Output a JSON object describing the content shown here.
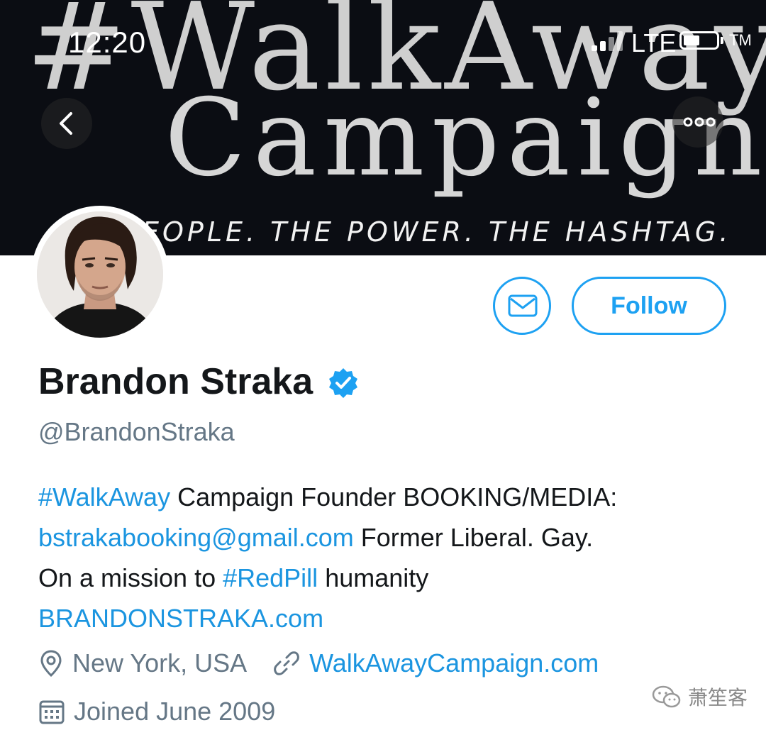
{
  "status_bar": {
    "time": "12:20",
    "network": "LTE",
    "tm": "TM"
  },
  "banner": {
    "line1": "#WalkAway",
    "line2": "Campaign",
    "tagline": "EOPLE.  THE POWER.  THE HASHTAG."
  },
  "profile": {
    "name": "Brandon Straka",
    "handle": "@BrandonStraka",
    "follow_label": "Follow",
    "bio": {
      "hashtag1": "#WalkAway",
      "text1": " Campaign Founder BOOKING/MEDIA:",
      "email": "bstrakabooking@gmail.com",
      "text2": " Former Liberal. Gay.",
      "text3": "On a mission to ",
      "hashtag2": "#RedPill",
      "text4": " humanity",
      "website": "BRANDONSTRAKA.com"
    },
    "location": "New York, USA",
    "url": "WalkAwayCampaign.com",
    "joined": "Joined June 2009"
  },
  "watermark": {
    "text": "萧笙客"
  },
  "colors": {
    "accent": "#1da1f2",
    "link": "#1b95e0",
    "muted": "#657786",
    "text": "#14171a",
    "banner_bg": "#0b0d13"
  },
  "icons": {
    "back": "chevron-left-icon",
    "more": "more-dots-icon",
    "message": "envelope-icon",
    "verified": "verified-badge-icon",
    "location": "location-pin-icon",
    "link": "link-icon",
    "calendar": "calendar-icon"
  }
}
